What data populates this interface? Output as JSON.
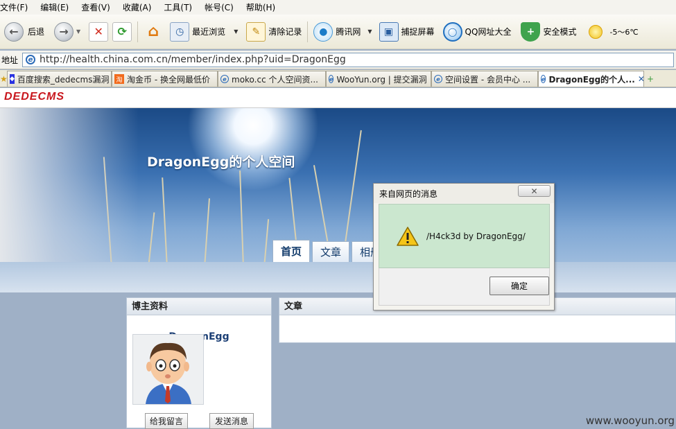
{
  "menu": [
    "文件(F)",
    "编辑(E)",
    "查看(V)",
    "收藏(A)",
    "工具(T)",
    "帐号(C)",
    "帮助(H)"
  ],
  "toolbar": {
    "back": "后退",
    "recent": "最近浏览",
    "clear": "清除记录",
    "tencent": "腾讯网",
    "capture": "捕捉屏幕",
    "qq_nav": "QQ网址大全",
    "safe": "安全模式",
    "weather": "-5～6℃"
  },
  "address": {
    "label": "地址",
    "url": "http://health.china.com.cn/member/index.php?uid=DragonEgg"
  },
  "tabs": [
    {
      "label": "百度搜索_dedecms漏洞"
    },
    {
      "label": "淘金币 - 换全网最低价"
    },
    {
      "label": "moko.cc 个人空间资..."
    },
    {
      "label": "WooYun.org | 提交漏洞"
    },
    {
      "label": "空间设置 - 会员中心 ..."
    },
    {
      "label": "DragonEgg的个人..."
    }
  ],
  "site": {
    "logo": "DEDECMS",
    "title": "DragonEgg的个人空间",
    "nav": [
      "首页",
      "文章",
      "相册"
    ]
  },
  "profile": {
    "heading": "博主资料",
    "name": "DragonEgg",
    "leave_msg": "给我留言",
    "send_msg": "发送消息"
  },
  "articles": {
    "heading": "文章"
  },
  "dialog": {
    "title": "来自网页的消息",
    "close": "✕",
    "message": "/H4ck3d by DragonEgg/",
    "ok": "确定"
  },
  "watermark": "www.wooyun.org"
}
